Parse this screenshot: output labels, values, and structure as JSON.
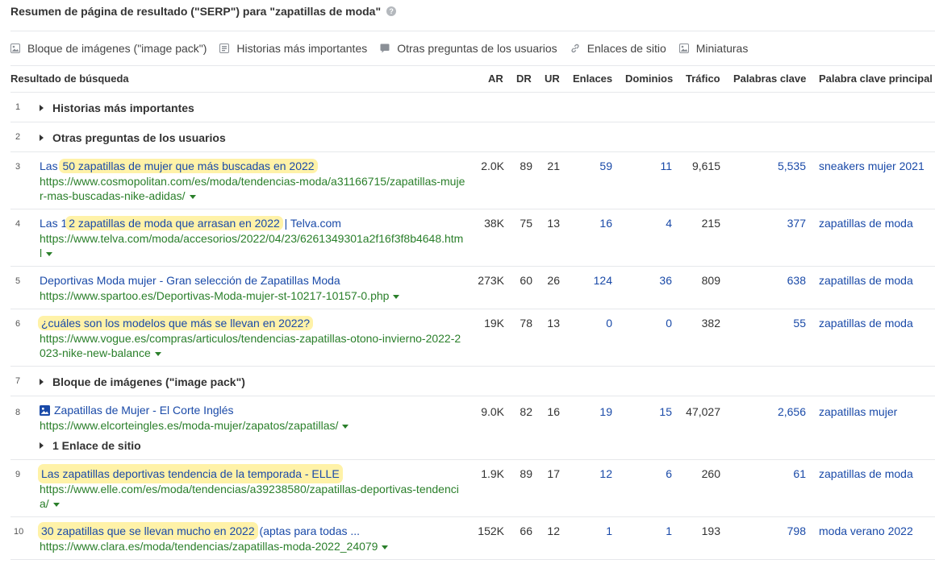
{
  "header": {
    "title": "Resumen de página de resultado (\"SERP\") para \"zapatillas de moda\"",
    "help": "?"
  },
  "features": [
    {
      "label": "Bloque de imágenes (\"image pack\")",
      "icon": "image-icon"
    },
    {
      "label": "Historias más importantes",
      "icon": "stories-icon"
    },
    {
      "label": "Otras preguntas de los usuarios",
      "icon": "question-icon"
    },
    {
      "label": "Enlaces de sitio",
      "icon": "link-icon"
    },
    {
      "label": "Miniaturas",
      "icon": "thumbnail-icon"
    }
  ],
  "columns": {
    "result": "Resultado de búsqueda",
    "ar": "AR",
    "dr": "DR",
    "ur": "UR",
    "links": "Enlaces",
    "domains": "Dominios",
    "traffic": "Tráfico",
    "keywords": "Palabras clave",
    "top_keyword": "Palabra clave principal"
  },
  "rows": [
    {
      "pos": "1",
      "feature": "Historias más importantes"
    },
    {
      "pos": "2",
      "feature": "Otras preguntas de los usuarios"
    },
    {
      "pos": "3",
      "pre": "Las ",
      "hl": "50 zapatillas de mujer que más buscadas en 2022",
      "post": "",
      "url": "https://www.cosmopolitan.com/es/moda/tendencias-moda/a31166715/zapatillas-mujer-mas-buscadas-nike-adidas/",
      "ar": "2.0K",
      "dr": "89",
      "ur": "21",
      "links": "59",
      "domains": "11",
      "traffic": "9,615",
      "keywords": "5,535",
      "top_keyword": "sneakers mujer 2021"
    },
    {
      "pos": "4",
      "pre": "Las 1",
      "hl": "2 zapatillas de moda que arrasan en 2022",
      "post": " | Telva.com",
      "url": "https://www.telva.com/moda/accesorios/2022/04/23/6261349301a2f16f3f8b4648.html",
      "ar": "38K",
      "dr": "75",
      "ur": "13",
      "links": "16",
      "domains": "4",
      "traffic": "215",
      "keywords": "377",
      "top_keyword": "zapatillas de moda"
    },
    {
      "pos": "5",
      "pre": "Deportivas Moda mujer - Gran selección de Zapatillas Moda",
      "hl": "",
      "post": "",
      "url": "https://www.spartoo.es/Deportivas-Moda-mujer-st-10217-10157-0.php",
      "ar": "273K",
      "dr": "60",
      "ur": "26",
      "links": "124",
      "domains": "36",
      "traffic": "809",
      "keywords": "638",
      "top_keyword": "zapatillas de moda"
    },
    {
      "pos": "6",
      "pre": "",
      "hl": "¿cuáles son los modelos que más se llevan en 2022?",
      "post": "",
      "url": "https://www.vogue.es/compras/articulos/tendencias-zapatillas-otono-invierno-2022-2023-nike-new-balance",
      "ar": "19K",
      "dr": "78",
      "ur": "13",
      "links": "0",
      "domains": "0",
      "traffic": "382",
      "keywords": "55",
      "top_keyword": "zapatillas de moda"
    },
    {
      "pos": "7",
      "feature": "Bloque de imágenes (\"image pack\")"
    },
    {
      "pos": "8",
      "pre": "Zapatillas de Mujer - El Corte Inglés",
      "hl": "",
      "post": "",
      "url": "https://www.elcorteingles.es/moda-mujer/zapatos/zapatillas/",
      "sitelinks": "1 Enlace de sitio",
      "ar": "9.0K",
      "dr": "82",
      "ur": "16",
      "links": "19",
      "domains": "15",
      "traffic": "47,027",
      "keywords": "2,656",
      "top_keyword": "zapatillas mujer"
    },
    {
      "pos": "9",
      "pre": "",
      "hl": "Las zapatillas deportivas tendencia de la temporada - ELLE",
      "post": "",
      "url": "https://www.elle.com/es/moda/tendencias/a39238580/zapatillas-deportivas-tendencia/",
      "ar": "1.9K",
      "dr": "89",
      "ur": "17",
      "links": "12",
      "domains": "6",
      "traffic": "260",
      "keywords": "61",
      "top_keyword": "zapatillas de moda"
    },
    {
      "pos": "10",
      "pre": "",
      "hl": "30 zapatillas que se llevan mucho en 2022",
      "post": " (aptas para todas ...",
      "url": "https://www.clara.es/moda/tendencias/zapatillas-moda-2022_24079",
      "ar": "152K",
      "dr": "66",
      "ur": "12",
      "links": "1",
      "domains": "1",
      "traffic": "193",
      "keywords": "798",
      "top_keyword": "moda verano 2022"
    }
  ]
}
